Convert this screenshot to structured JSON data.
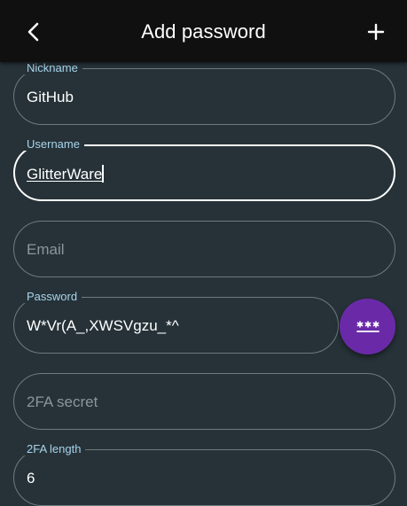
{
  "appbar": {
    "title": "Add password",
    "back_icon": "chevron-left-icon",
    "add_icon": "plus-icon"
  },
  "fields": {
    "nickname": {
      "label": "Nickname",
      "value": "GitHub"
    },
    "username": {
      "label": "Username",
      "value": "GlitterWare"
    },
    "email": {
      "placeholder": "Email"
    },
    "password": {
      "label": "Password",
      "value": "W*Vr(A_,XWSVgzu_*^"
    },
    "twofa_secret": {
      "placeholder": "2FA secret"
    },
    "twofa_length": {
      "label": "2FA length",
      "value": "6"
    }
  },
  "generate_button": {
    "icon": "password-dots-icon"
  },
  "colors": {
    "background": "#263238",
    "appbar": "#101010",
    "label": "#a8d4ec",
    "outline": "#6f7a7f",
    "fab": "#6a2aa8"
  }
}
